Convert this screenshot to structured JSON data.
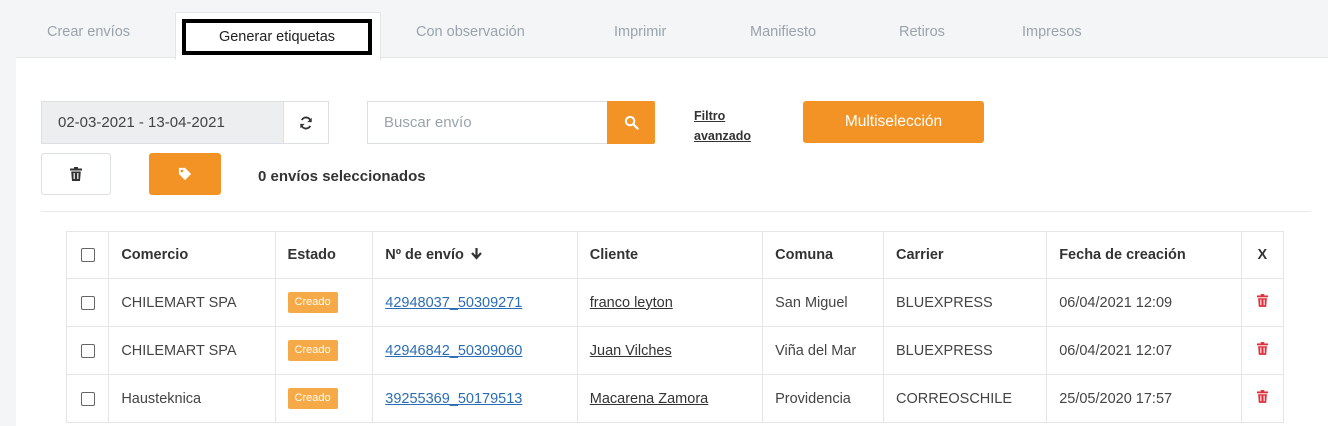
{
  "tabs": [
    {
      "label": "Crear envíos"
    },
    {
      "label": "Generar etiquetas"
    },
    {
      "label": "Con observación"
    },
    {
      "label": "Imprimir"
    },
    {
      "label": "Manifiesto"
    },
    {
      "label": "Retiros"
    },
    {
      "label": "Impresos"
    }
  ],
  "toolbar": {
    "date_range": "02-03-2021 - 13-04-2021",
    "search_placeholder": "Buscar envío",
    "filter_line1": "Filtro",
    "filter_line2": "avanzado",
    "multi_label": "Multiselección",
    "selected_count": "0 envíos seleccionados"
  },
  "colors": {
    "accent": "#f39325",
    "badge": "#f6a947",
    "link": "#2a6db5",
    "delete": "#e0303a"
  },
  "table": {
    "headers": {
      "comercio": "Comercio",
      "estado": "Estado",
      "envio": "Nº de envío",
      "cliente": "Cliente",
      "comuna": "Comuna",
      "carrier": "Carrier",
      "fecha": "Fecha de creación",
      "x": "X"
    },
    "rows": [
      {
        "comercio": "CHILEMART SPA",
        "estado": "Creado",
        "envio": "42948037_50309271",
        "cliente": "franco leyton",
        "comuna": "San Miguel",
        "carrier": "BLUEXPRESS",
        "fecha": "06/04/2021 12:09"
      },
      {
        "comercio": "CHILEMART SPA",
        "estado": "Creado",
        "envio": "42946842_50309060",
        "cliente": "Juan Vilches",
        "comuna": "Viña del Mar",
        "carrier": "BLUEXPRESS",
        "fecha": "06/04/2021 12:07"
      },
      {
        "comercio": "Hausteknica",
        "estado": "Creado",
        "envio": "39255369_50179513",
        "cliente": "Macarena Zamora",
        "comuna": "Providencia",
        "carrier": "CORREOSCHILE",
        "fecha": "25/05/2020 17:57"
      }
    ]
  }
}
